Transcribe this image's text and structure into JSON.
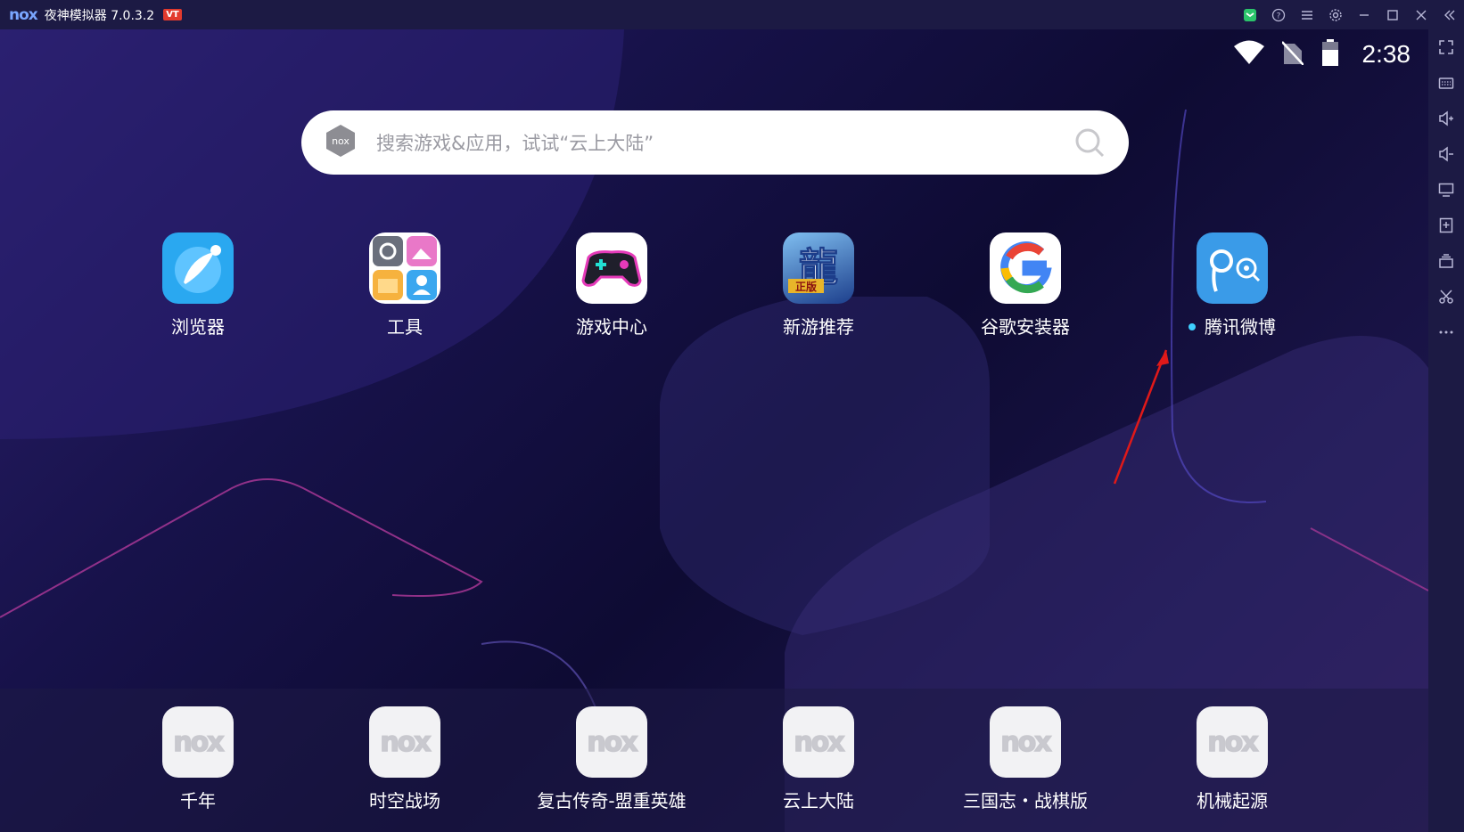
{
  "window": {
    "brand": "nox",
    "title": "夜神模拟器 7.0.3.2",
    "badge": "VT"
  },
  "title_controls": [
    "assistant-icon",
    "help-icon",
    "menu-icon",
    "settings-icon",
    "minimize-icon",
    "maximize-icon",
    "close-icon",
    "collapse-sidebar-icon"
  ],
  "status_bar": {
    "time": "2:38"
  },
  "search": {
    "placeholder": "搜索游戏&应用，试试“云上大陆”"
  },
  "home_apps": [
    {
      "label": "浏览器"
    },
    {
      "label": "工具"
    },
    {
      "label": "游戏中心"
    },
    {
      "label": "新游推荐"
    },
    {
      "label": "谷歌安装器"
    },
    {
      "label": "腾讯微博",
      "new_dot": true
    }
  ],
  "dock_apps": [
    {
      "label": "千年"
    },
    {
      "label": "时空战场"
    },
    {
      "label": "复古传奇-盟重英雄"
    },
    {
      "label": "云上大陆"
    },
    {
      "label": "三国志・战棋版"
    },
    {
      "label": "机械起源"
    }
  ],
  "placeholder_logo": "nox",
  "sidebar_tools": [
    "fullscreen-icon",
    "keyboard-icon",
    "volume-up-icon",
    "volume-down-icon",
    "screen-icon",
    "add-apk-icon",
    "multi-instance-icon",
    "cut-icon",
    "more-icon"
  ],
  "colors": {
    "titlebar": "#1c1a44",
    "accent": "#3fd0ff",
    "badge": "#e23a2d",
    "arrow": "#e01919"
  }
}
